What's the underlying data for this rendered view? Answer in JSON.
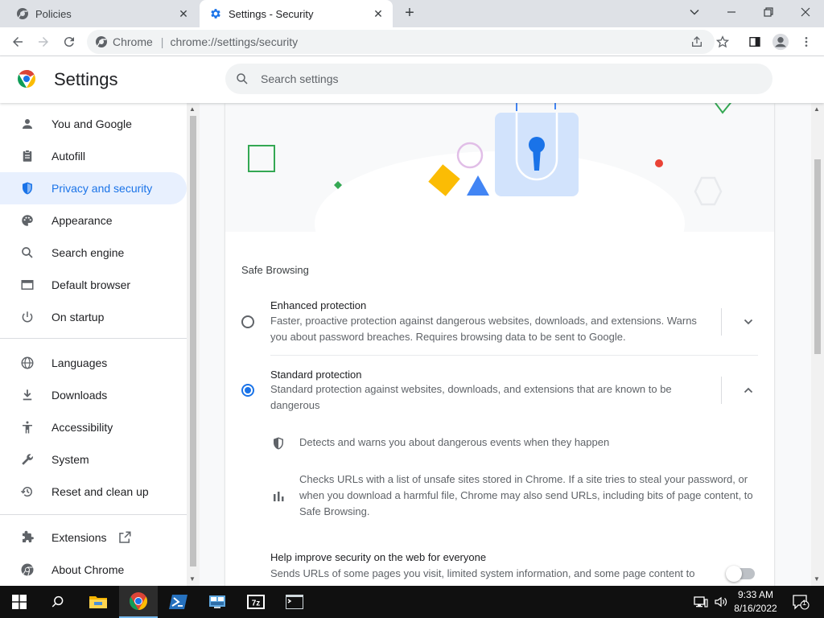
{
  "tabs": [
    {
      "title": "Policies",
      "close": "✕"
    },
    {
      "title": "Settings - Security",
      "close": "✕"
    }
  ],
  "new_tab_label": "+",
  "window_controls": {
    "dropdown": "⌄",
    "minimize": "—",
    "restore": "❐",
    "close": "✕"
  },
  "omnibox": {
    "site": "Chrome",
    "separator": "|",
    "url": "chrome://settings/security"
  },
  "settings": {
    "title": "Settings",
    "search_placeholder": "Search settings"
  },
  "sidebar": {
    "items": [
      {
        "label": "You and Google",
        "icon": "person-icon"
      },
      {
        "label": "Autofill",
        "icon": "clipboard-icon"
      },
      {
        "label": "Privacy and security",
        "icon": "shield-icon",
        "selected": true
      },
      {
        "label": "Appearance",
        "icon": "palette-icon"
      },
      {
        "label": "Search engine",
        "icon": "search-icon"
      },
      {
        "label": "Default browser",
        "icon": "browser-icon"
      },
      {
        "label": "On startup",
        "icon": "power-icon"
      },
      {
        "label": "Languages",
        "icon": "globe-icon"
      },
      {
        "label": "Downloads",
        "icon": "download-icon"
      },
      {
        "label": "Accessibility",
        "icon": "accessibility-icon"
      },
      {
        "label": "System",
        "icon": "wrench-icon"
      },
      {
        "label": "Reset and clean up",
        "icon": "history-icon"
      },
      {
        "label": "Extensions",
        "icon": "puzzle-icon"
      },
      {
        "label": "About Chrome",
        "icon": "chrome-icon"
      }
    ]
  },
  "main": {
    "section_title": "Safe Browsing",
    "enhanced": {
      "label": "Enhanced protection",
      "description": "Faster, proactive protection against dangerous websites, downloads, and extensions. Warns you about password breaches. Requires browsing data to be sent to Google.",
      "checked": false
    },
    "standard": {
      "label": "Standard protection",
      "description": "Standard protection against websites, downloads, and extensions that are known to be dangerous",
      "checked": true
    },
    "details": [
      {
        "icon": "shield-icon",
        "text": "Detects and warns you about dangerous events when they happen"
      },
      {
        "icon": "bar-chart-icon",
        "text": "Checks URLs with a list of unsafe sites stored in Chrome. If a site tries to steal your password, or when you download a harmful file, Chrome may also send URLs, including bits of page content, to Safe Browsing."
      }
    ],
    "help_improve": {
      "label": "Help improve security on the web for everyone",
      "description": "Sends URLs of some pages you visit, limited system information, and some page content to",
      "enabled": false
    }
  },
  "taskbar": {
    "time": "9:33 AM",
    "date": "8/16/2022",
    "notification_count": "1",
    "apps": [
      "windows-start",
      "search",
      "file-explorer",
      "chrome",
      "powershell",
      "network-app",
      "7zip",
      "terminal"
    ]
  },
  "colors": {
    "accent": "#1a73e8",
    "selected_bg": "#e8f0fe",
    "tabstrip": "#dee1e6",
    "taskbar": "#101010"
  }
}
